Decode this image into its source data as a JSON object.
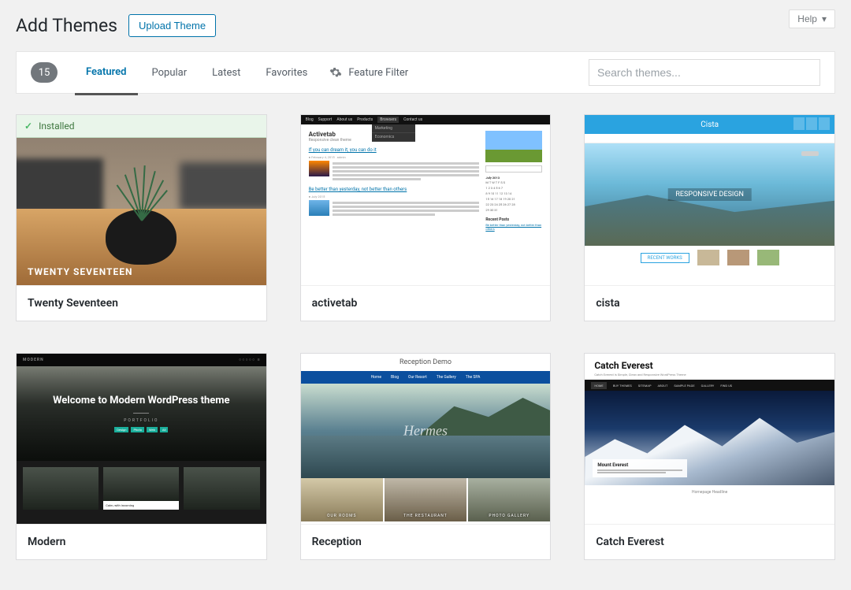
{
  "header": {
    "page_title": "Add Themes",
    "upload_button": "Upload Theme",
    "help_button": "Help"
  },
  "filter": {
    "count": "15",
    "tabs": {
      "featured": "Featured",
      "popular": "Popular",
      "latest": "Latest",
      "favorites": "Favorites"
    },
    "feature_filter": "Feature Filter",
    "search_placeholder": "Search themes..."
  },
  "themes": {
    "installed_label": "Installed",
    "t1": {
      "name": "Twenty Seventeen",
      "preview_title": "TWENTY SEVENTEEN"
    },
    "t2": {
      "name": "activetab",
      "preview": {
        "brand": "Activetab",
        "tagline": "Responsive clean theme",
        "link1": "If you can dream it, you can do it",
        "link2": "Be better than yesterday, not better than others",
        "recent_posts": "Recent Posts"
      }
    },
    "t3": {
      "name": "cista",
      "preview": {
        "brand": "Cista",
        "hero_label": "RESPONSIVE DESIGN",
        "recent": "RECENT WORKS"
      }
    },
    "t4": {
      "name": "Modern",
      "preview": {
        "brand": "MODERN",
        "headline": "Welcome to Modern WordPress theme",
        "section": "PORTFOLIO"
      }
    },
    "t5": {
      "name": "Reception",
      "preview": {
        "title": "Reception Demo",
        "logo": "Hermes",
        "c1": "OUR ROOMS",
        "c2": "THE RESTAURANT",
        "c3": "PHOTO GALLERY"
      }
    },
    "t6": {
      "name": "Catch Everest",
      "preview": {
        "title": "Catch Everest",
        "caption": "Mount Everest",
        "footer": "Homepage Headline"
      }
    }
  }
}
